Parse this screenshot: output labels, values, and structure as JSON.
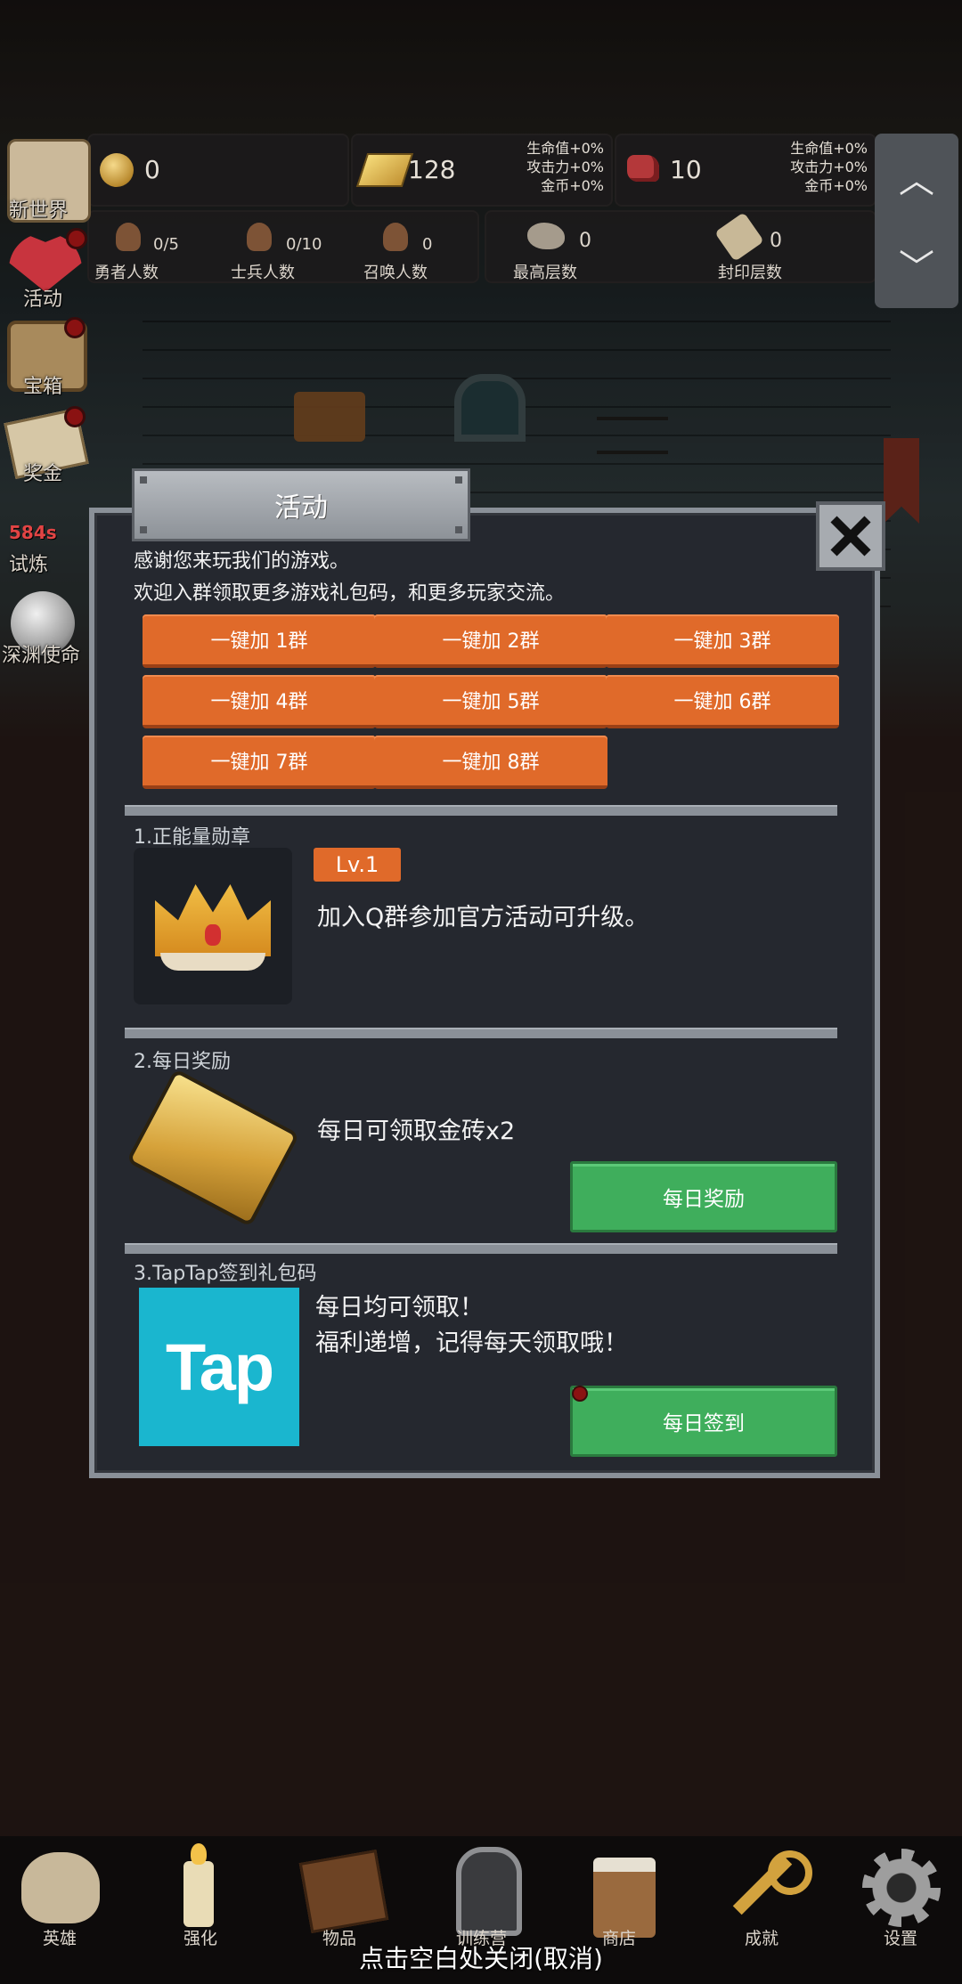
{
  "resources": {
    "coin": {
      "value": "0",
      "icon": "coin-icon"
    },
    "gold_brick": {
      "value": "128",
      "icon": "gold-brick-icon",
      "bonus": [
        "生命值+0%",
        "攻击力+0%",
        "金币+0%"
      ]
    },
    "gem": {
      "value": "10",
      "icon": "red-gem-icon",
      "bonus": [
        "生命值+0%",
        "攻击力+0%",
        "金币+0%"
      ]
    }
  },
  "stats": [
    {
      "value": "0/5",
      "label": "勇者人数"
    },
    {
      "value": "0/10",
      "label": "士兵人数"
    },
    {
      "value": "0",
      "label": "召唤人数"
    }
  ],
  "floors": [
    {
      "value": "0",
      "label": "最高层数"
    },
    {
      "value": "0",
      "label": "封印层数"
    }
  ],
  "side_menu": [
    {
      "label": "新世界",
      "badge": false
    },
    {
      "label": "活动",
      "badge": true
    },
    {
      "label": "宝箱",
      "badge": true
    },
    {
      "label": "奖金",
      "badge": true
    },
    {
      "label": "试炼",
      "badge": false,
      "timer": "584s"
    },
    {
      "label": "深渊使命",
      "badge": false
    }
  ],
  "dialog": {
    "title": "活动",
    "intro_line1": "感谢您来玩我们的游戏。",
    "intro_line2": "欢迎入群领取更多游戏礼包码，和更多玩家交流。",
    "group_buttons": [
      "一键加 1群",
      "一键加 2群",
      "一键加 3群",
      "一键加 4群",
      "一键加 5群",
      "一键加 6群",
      "一键加 7群",
      "一键加 8群"
    ],
    "section1": {
      "title": "1.正能量勋章",
      "level": "Lv.1",
      "desc": "加入Q群参加官方活动可升级。"
    },
    "section2": {
      "title": "2.每日奖励",
      "desc": "每日可领取金砖x2",
      "button": "每日奖励"
    },
    "section3": {
      "title": "3.TapTap签到礼包码",
      "logo_text": "Tap",
      "desc_line1": "每日均可领取！",
      "desc_line2": "福利递增，记得每天领取哦！",
      "button": "每日签到"
    }
  },
  "bottom_nav": [
    "英雄",
    "强化",
    "物品",
    "训练营",
    "商店",
    "成就",
    "设置"
  ],
  "close_hint": "点击空白处关闭(取消)",
  "colors": {
    "orange_button": "#e06a2a",
    "green_button": "#3fae5c",
    "tap_logo_bg": "#1ab6cf",
    "dialog_bg": "#25282f"
  }
}
